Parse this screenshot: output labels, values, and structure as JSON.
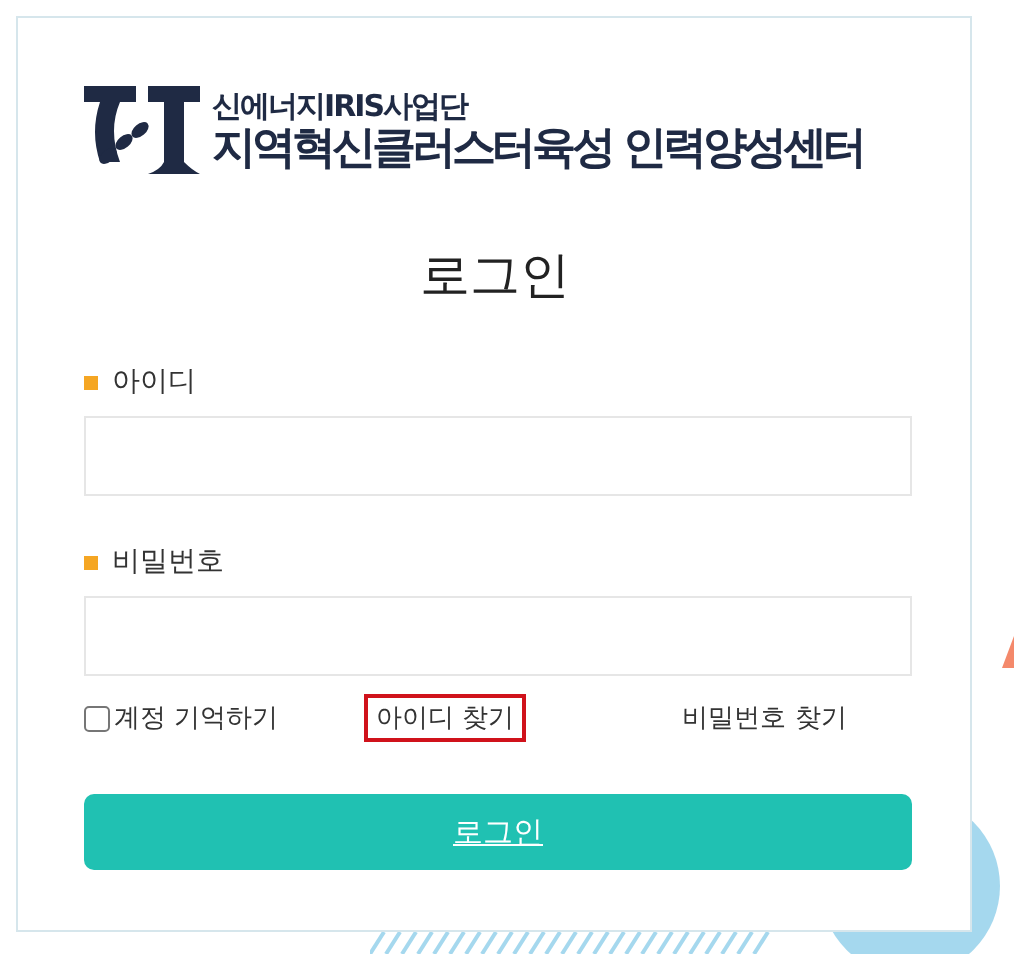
{
  "logo": {
    "line_1": "신에너지IRIS사업단",
    "line_2": "지역혁신클러스터육성 인력양성센터"
  },
  "title": "로그인",
  "fields": [
    {
      "label": "아이디"
    },
    {
      "label": "비밀번호"
    }
  ],
  "remember": {
    "label": "계정 기억하기",
    "checked": false
  },
  "links": [
    {
      "label": "아이디 찾기",
      "highlighted": true
    },
    {
      "label": "비밀번호 찾기",
      "highlighted": false
    }
  ],
  "login_button": "로그인"
}
